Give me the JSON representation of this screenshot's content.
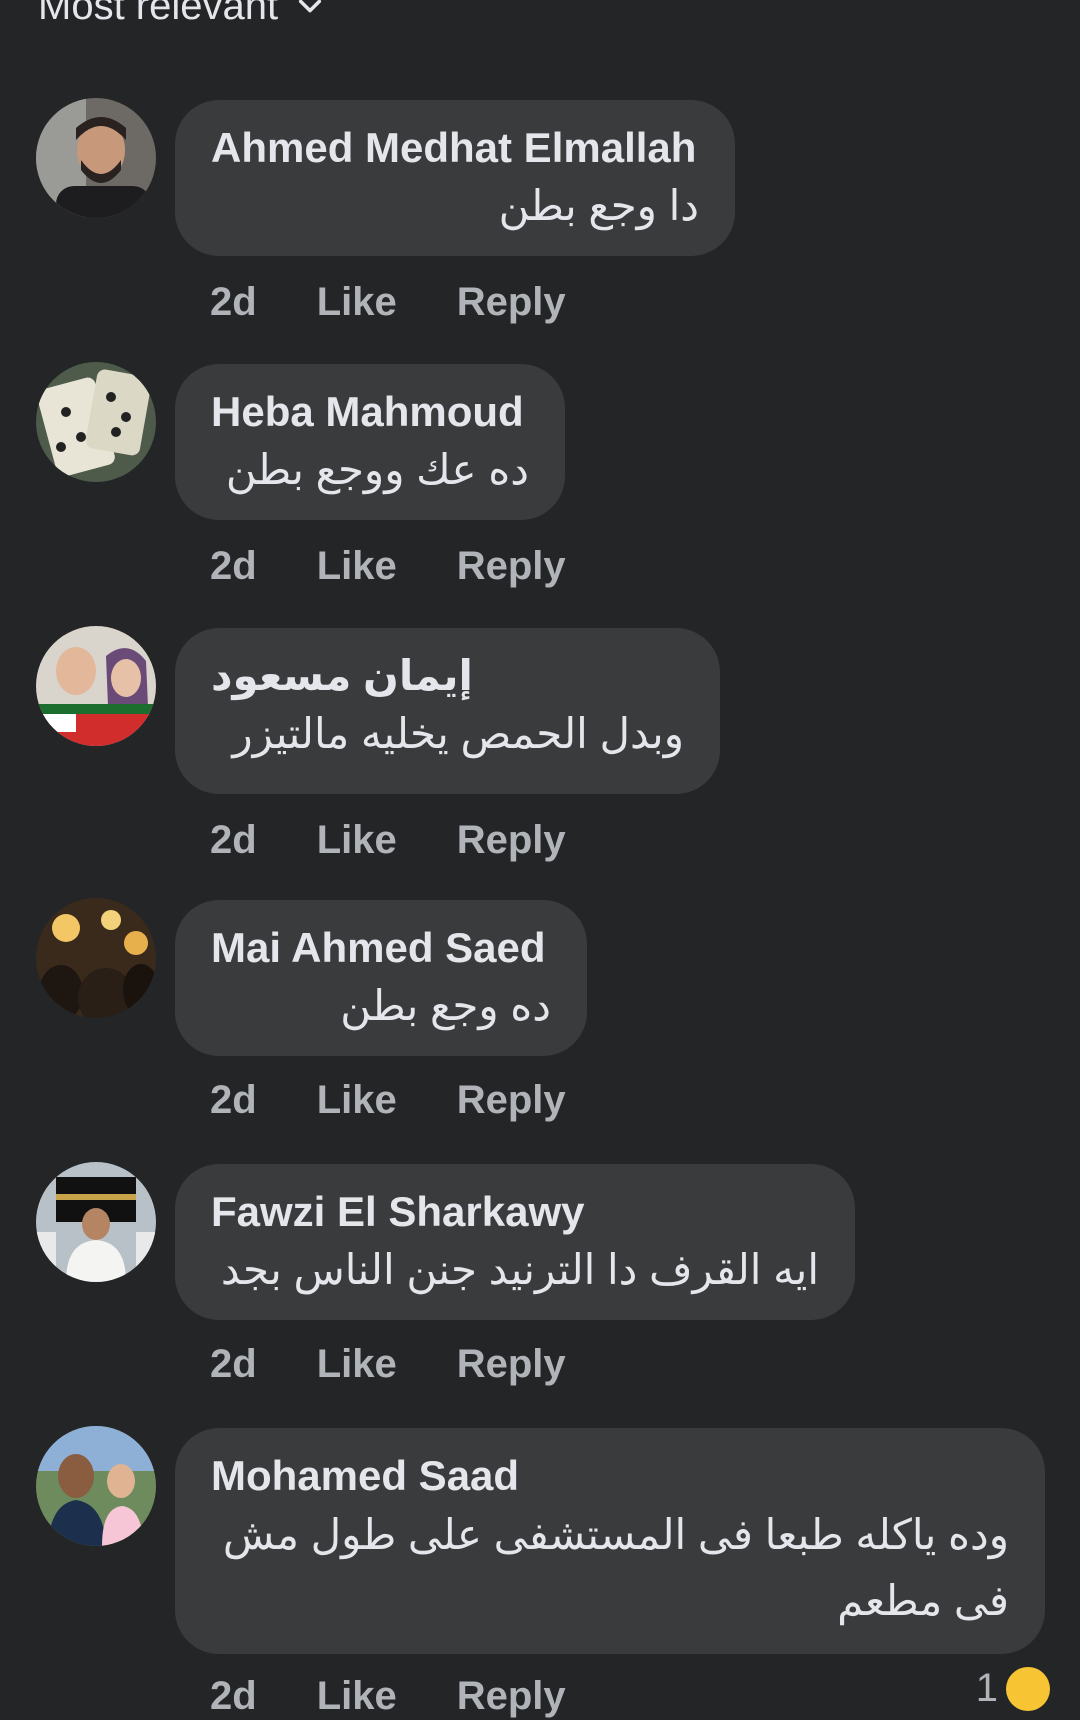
{
  "sort": {
    "label": "Most relevant"
  },
  "comments": [
    {
      "author": "Ahmed Medhat Elmallah",
      "text": "دا وجع بطن",
      "time": "2d",
      "like": "Like",
      "reply": "Reply"
    },
    {
      "author": "Heba Mahmoud",
      "text": "ده عك ووجع بطن",
      "time": "2d",
      "like": "Like",
      "reply": "Reply"
    },
    {
      "author": "إيمان مسعود",
      "text": "وبدل الحمص يخليه مالتيزر",
      "time": "2d",
      "like": "Like",
      "reply": "Reply"
    },
    {
      "author": "Mai Ahmed Saed",
      "text": "ده وجع بطن",
      "time": "2d",
      "like": "Like",
      "reply": "Reply"
    },
    {
      "author": "Fawzi El Sharkawy",
      "text": "ايه القرف دا الترنيد جنن الناس بجد",
      "time": "2d",
      "like": "Like",
      "reply": "Reply"
    },
    {
      "author": "Mohamed Saad",
      "text": "وده ياكله طبعا فى المستشفى على طول مش فى مطعم",
      "time": "2d",
      "like": "Like",
      "reply": "Reply",
      "reaction_count": "1"
    }
  ],
  "colors": {
    "background": "#242526",
    "bubble": "#3a3b3c",
    "text": "#e4e6eb",
    "secondary": "#b0b3b8"
  }
}
